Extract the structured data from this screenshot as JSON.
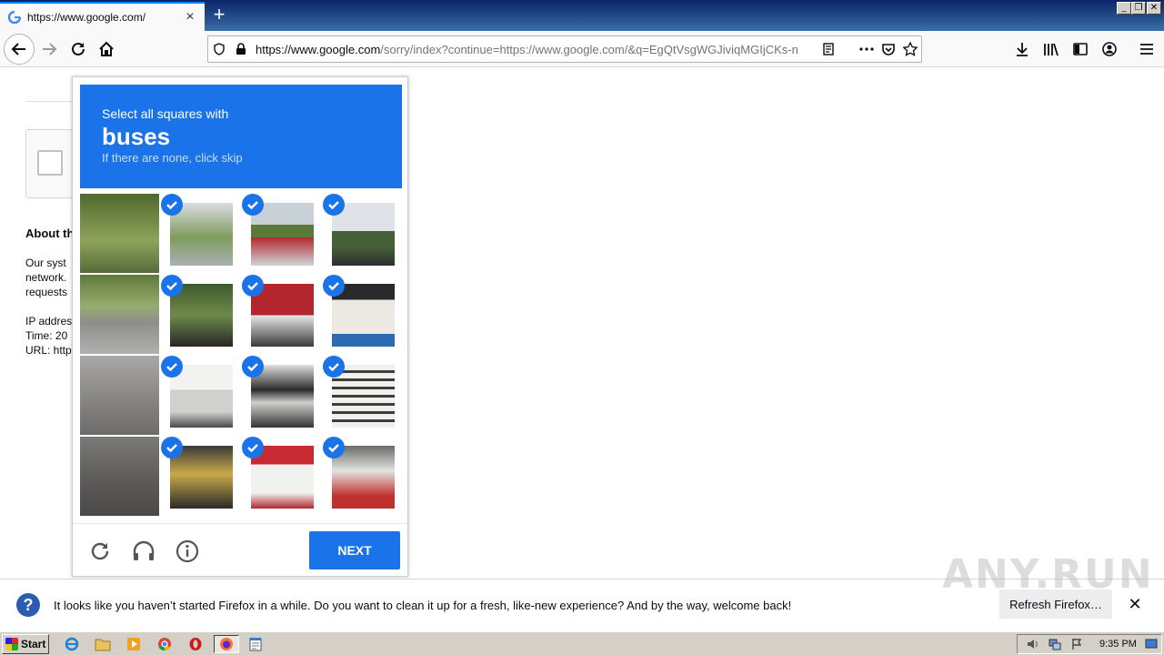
{
  "browser": {
    "tab_title": "https://www.google.com/",
    "new_tab_label": "+",
    "url_domain": "https://www.google.com",
    "url_path": "/sorry/index?continue=https://www.google.com/&q=EgQtVsgWGJiviqMGIjCKs-n",
    "window_buttons": [
      "_",
      "❐",
      "✕"
    ]
  },
  "page": {
    "about_heading": "About th",
    "lines": [
      "Our syst",
      "network.",
      "requests",
      "IP addres",
      "Time: 20",
      "URL: http"
    ]
  },
  "captcha": {
    "instruction_line1": "Select all squares with",
    "target": "buses",
    "instruction_line3": "If there are none, click skip",
    "next_label": "NEXT",
    "selected": [
      [
        false,
        true,
        true,
        true
      ],
      [
        false,
        true,
        true,
        true
      ],
      [
        false,
        true,
        true,
        true
      ],
      [
        false,
        true,
        true,
        true
      ]
    ],
    "colors": {
      "accent": "#1a73e8"
    }
  },
  "notification": {
    "message": "It looks like you haven’t started Firefox in a while. Do you want to clean it up for a fresh, like-new experience? And by the way, welcome back!",
    "refresh_label": "Refresh Firefox…"
  },
  "watermark": "ANY.RUN",
  "taskbar": {
    "start_label": "Start",
    "clock": "9:35 PM"
  }
}
